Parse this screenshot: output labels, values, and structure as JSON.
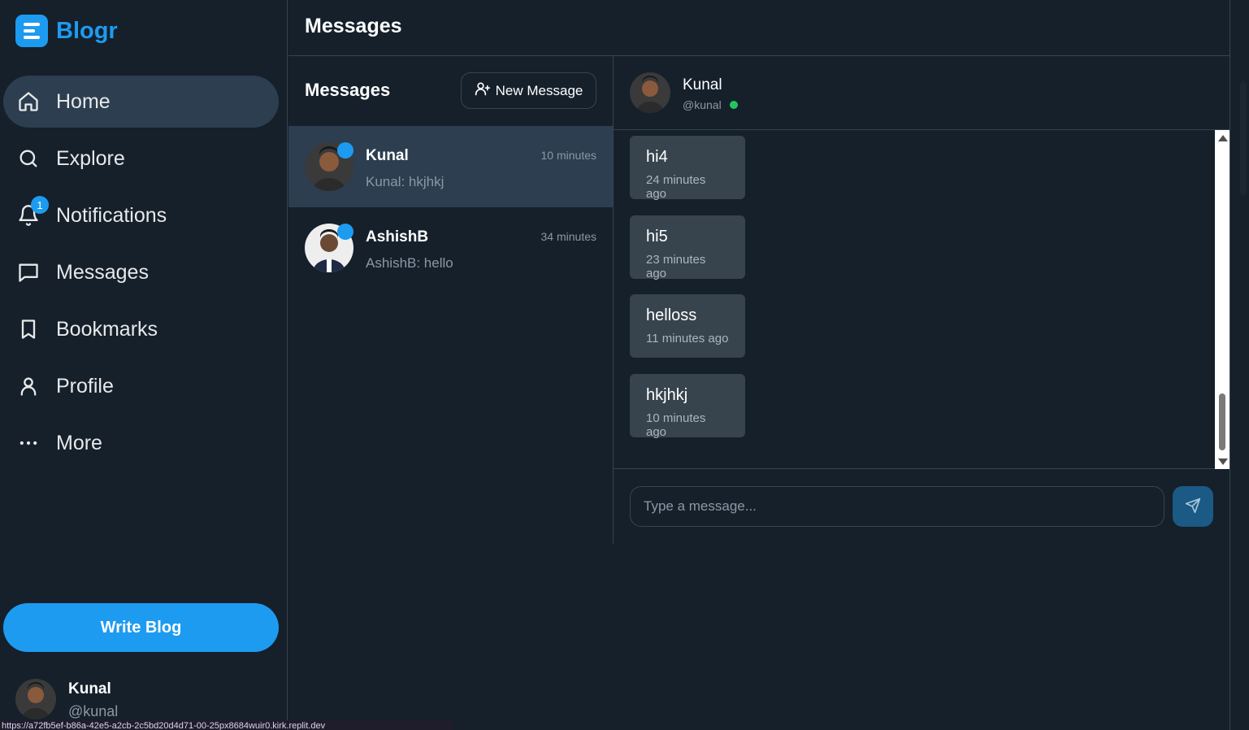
{
  "app": {
    "name": "Blogr",
    "accent_color": "#1d9bf0",
    "status_url": "https://a72fb5ef-b86a-42e5-a2cb-2c5bd20d4d71-00-25px8684wuir0.kirk.replit.dev"
  },
  "sidebar": {
    "items": [
      {
        "label": "Home",
        "icon": "home-icon",
        "active": true
      },
      {
        "label": "Explore",
        "icon": "search-icon"
      },
      {
        "label": "Notifications",
        "icon": "bell-icon",
        "badge": "1"
      },
      {
        "label": "Messages",
        "icon": "message-icon"
      },
      {
        "label": "Bookmarks",
        "icon": "bookmark-icon"
      },
      {
        "label": "Profile",
        "icon": "user-icon"
      },
      {
        "label": "More",
        "icon": "more-icon"
      }
    ],
    "write_button": "Write Blog",
    "user": {
      "name": "Kunal",
      "handle": "@kunal"
    }
  },
  "header": {
    "title": "Messages"
  },
  "conversations": {
    "title": "Messages",
    "new_button": "New Message",
    "items": [
      {
        "name": "Kunal",
        "time": "10 minutes",
        "preview": "Kunal: hkjhkj",
        "active": true
      },
      {
        "name": "AshishB",
        "time": "34 minutes",
        "preview": "AshishB: hello"
      }
    ]
  },
  "chat": {
    "name": "Kunal",
    "handle": "@kunal",
    "messages": [
      {
        "text": "hi4",
        "time": "24 minutes ago"
      },
      {
        "text": "hi5",
        "time": "23 minutes ago"
      },
      {
        "text": "helloss",
        "time": "11 minutes ago"
      },
      {
        "text": "hkjhkj",
        "time": "10 minutes ago"
      }
    ],
    "input_placeholder": "Type a message..."
  }
}
